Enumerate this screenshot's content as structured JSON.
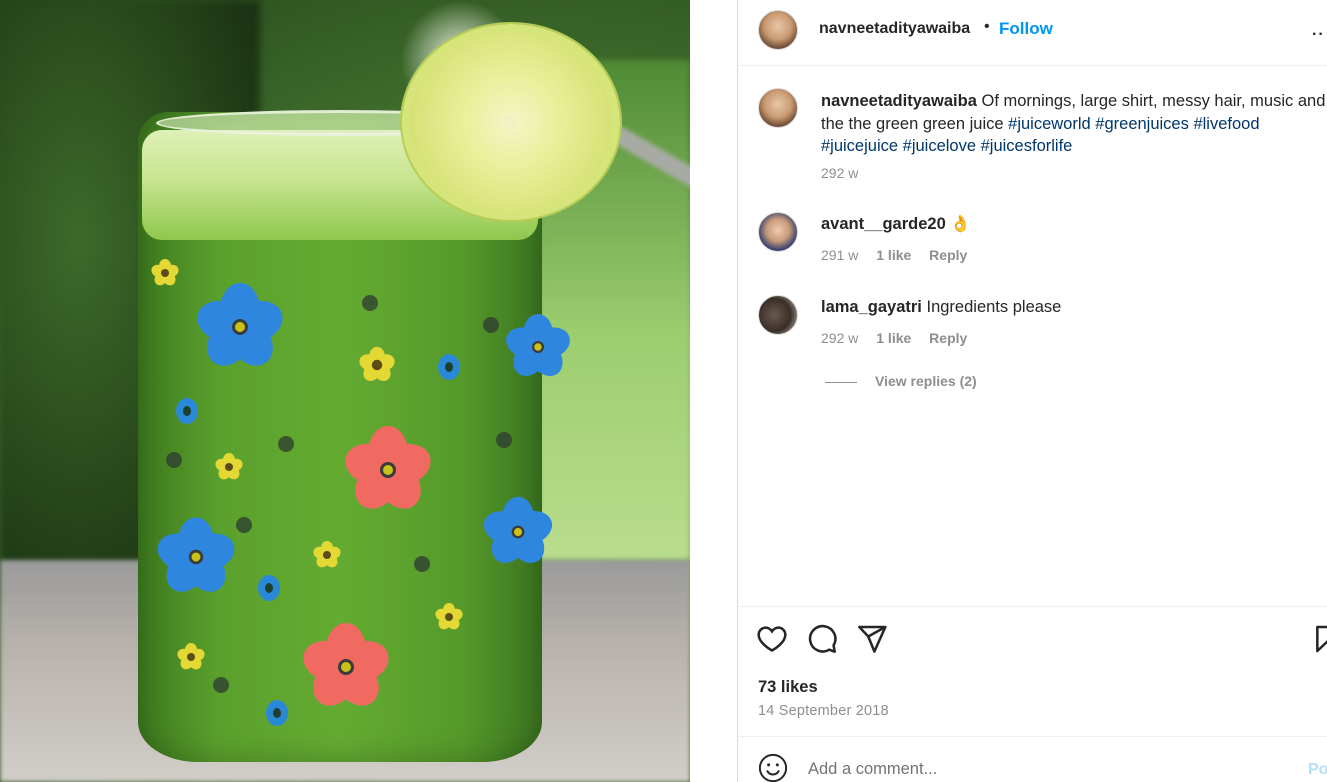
{
  "post": {
    "image_alt_icon": "photo-green-juice-glass",
    "header": {
      "username": "navneetadityawaiba",
      "separator": "•",
      "follow_label": "Follow",
      "more_label": "··"
    },
    "caption": {
      "username": "navneetadityawaiba",
      "text": "Of mornings, large shirt, messy hair, music and the the green green juice",
      "hashtags": [
        "#juiceworld",
        "#greenjuices",
        "#livefood",
        "#juicejuice",
        "#juicelove",
        "#juicesforlife"
      ],
      "time": "292 w"
    },
    "comments": [
      {
        "username": "avant__garde20",
        "text": "👌",
        "time": "291 w",
        "likes": "1 like",
        "reply_label": "Reply"
      },
      {
        "username": "lama_gayatri",
        "text": "Ingredients please",
        "time": "292 w",
        "likes": "1 like",
        "reply_label": "Reply"
      }
    ],
    "view_replies_label": "View replies (2)",
    "actions": {
      "icons": [
        "heart-icon",
        "comment-icon",
        "share-icon",
        "bookmark-icon"
      ]
    },
    "likes_label": "73 likes",
    "date_label": "14 September 2018",
    "add_comment": {
      "placeholder": "Add a comment...",
      "post_label": "Post"
    }
  },
  "colors": {
    "accent": "#0095f6",
    "hashtag": "#00376b",
    "muted": "#8e8e8e",
    "text": "#262626",
    "post_disabled": "#b2dffc"
  }
}
